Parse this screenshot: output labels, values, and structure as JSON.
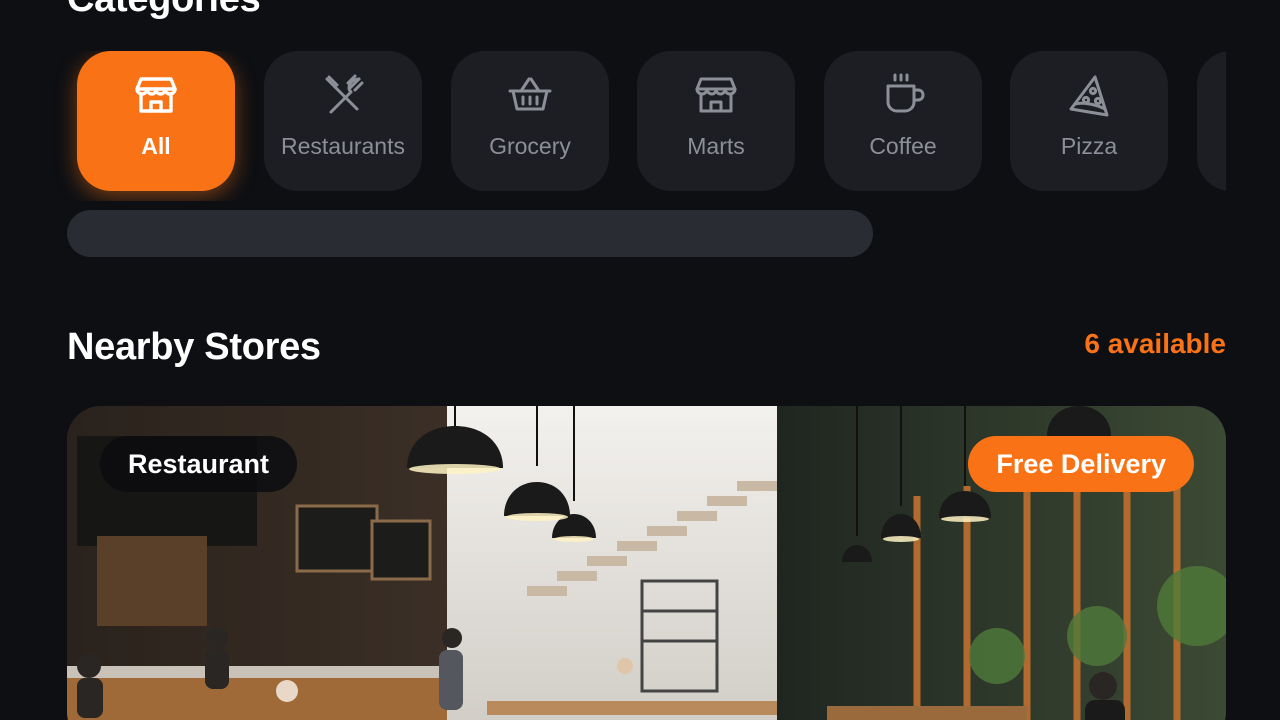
{
  "sections": {
    "categories_title": "Categories",
    "nearby_title": "Nearby Stores",
    "available_text": "6 available"
  },
  "categories": [
    {
      "label": "All",
      "icon": "storefront-icon",
      "active": true
    },
    {
      "label": "Restaurants",
      "icon": "fork-knife-icon",
      "active": false
    },
    {
      "label": "Grocery",
      "icon": "basket-icon",
      "active": false
    },
    {
      "label": "Marts",
      "icon": "storefront-icon",
      "active": false
    },
    {
      "label": "Coffee",
      "icon": "coffee-cup-icon",
      "active": false
    },
    {
      "label": "Pizza",
      "icon": "pizza-slice-icon",
      "active": false
    }
  ],
  "store_card": {
    "type_badge": "Restaurant",
    "delivery_badge": "Free Delivery"
  },
  "colors": {
    "accent": "#f97316",
    "background": "#0d0f13",
    "chip": "#1c1e24",
    "muted_text": "#8c8f97"
  }
}
